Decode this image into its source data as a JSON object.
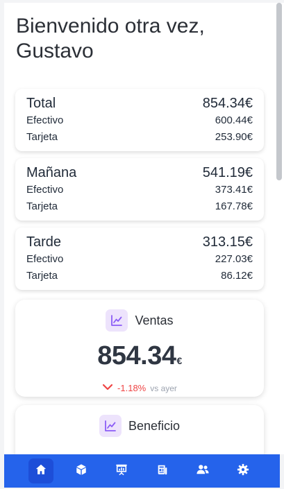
{
  "greeting": "Bienvenido otra vez, Gustavo",
  "summary_cards": [
    {
      "title": "Total",
      "total": "854.34€",
      "rows": [
        {
          "label": "Efectivo",
          "value": "600.44€"
        },
        {
          "label": "Tarjeta",
          "value": "253.90€"
        }
      ]
    },
    {
      "title": "Mañana",
      "total": "541.19€",
      "rows": [
        {
          "label": "Efectivo",
          "value": "373.41€"
        },
        {
          "label": "Tarjeta",
          "value": "167.78€"
        }
      ]
    },
    {
      "title": "Tarde",
      "total": "313.15€",
      "rows": [
        {
          "label": "Efectivo",
          "value": "227.03€"
        },
        {
          "label": "Tarjeta",
          "value": "86.12€"
        }
      ]
    }
  ],
  "kpis": {
    "ventas": {
      "title": "Ventas",
      "value": "854.34",
      "currency": "€",
      "trend_pct": "-1.18%",
      "trend_note": "vs ayer",
      "trend_direction": "down",
      "icon": "chart-line-icon"
    },
    "beneficio": {
      "title": "Beneficio",
      "value": "",
      "currency": "",
      "icon": "chart-line-icon"
    }
  },
  "nav": {
    "items": [
      {
        "name": "home",
        "icon": "home-icon",
        "active": true
      },
      {
        "name": "products",
        "icon": "box-icon",
        "active": false
      },
      {
        "name": "presentation",
        "icon": "presentation-chart-icon",
        "active": false
      },
      {
        "name": "reports",
        "icon": "newspaper-icon",
        "active": false
      },
      {
        "name": "users",
        "icon": "users-icon",
        "active": false
      },
      {
        "name": "settings",
        "icon": "gear-icon",
        "active": false
      }
    ]
  },
  "colors": {
    "nav_bg": "#2563eb",
    "nav_active": "#1d4ed8",
    "trend_down": "#ef4444",
    "icon_bg": "#ede3fc",
    "icon_fg": "#8b5cf6"
  }
}
